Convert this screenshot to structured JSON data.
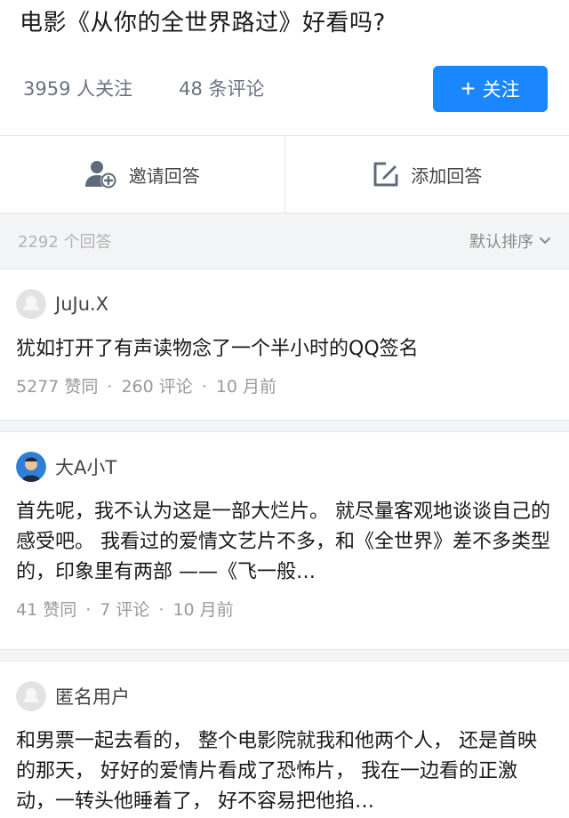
{
  "question": {
    "title": "电影《从你的全世界路过》好看吗?",
    "followers": "3959 人关注",
    "comments": "48 条评论",
    "follow_button": "关注"
  },
  "actions": {
    "invite": "邀请回答",
    "write": "添加回答"
  },
  "answers_bar": {
    "count": "2292 个回答",
    "sort": "默认排序"
  },
  "answers": [
    {
      "author": "JuJu.X",
      "content": "犹如打开了有声读物念了一个半小时的QQ签名",
      "likes": "5277 赞同",
      "comments": "260 评论",
      "time": "10 月前"
    },
    {
      "author": "大A小T",
      "content": "首先呢，我不认为这是一部大烂片。 就尽量客观地谈谈自己的感受吧。 我看过的爱情文艺片不多，和《全世界》差不多类型的，印象里有两部 ——《飞一般…",
      "likes": "41 赞同",
      "comments": "7 评论",
      "time": "10 月前"
    },
    {
      "author": "匿名用户",
      "content": "和男票一起去看的， 整个电影院就我和他两个人， 还是首映的那天， 好好的爱情片看成了恐怖片， 我在一边看的正激动，一转头他睡着了， 好不容易把他掐…"
    }
  ],
  "colors": {
    "accent": "#1a86ff",
    "muted": "#9a9a9a",
    "background_gray": "#f4f5f6"
  }
}
